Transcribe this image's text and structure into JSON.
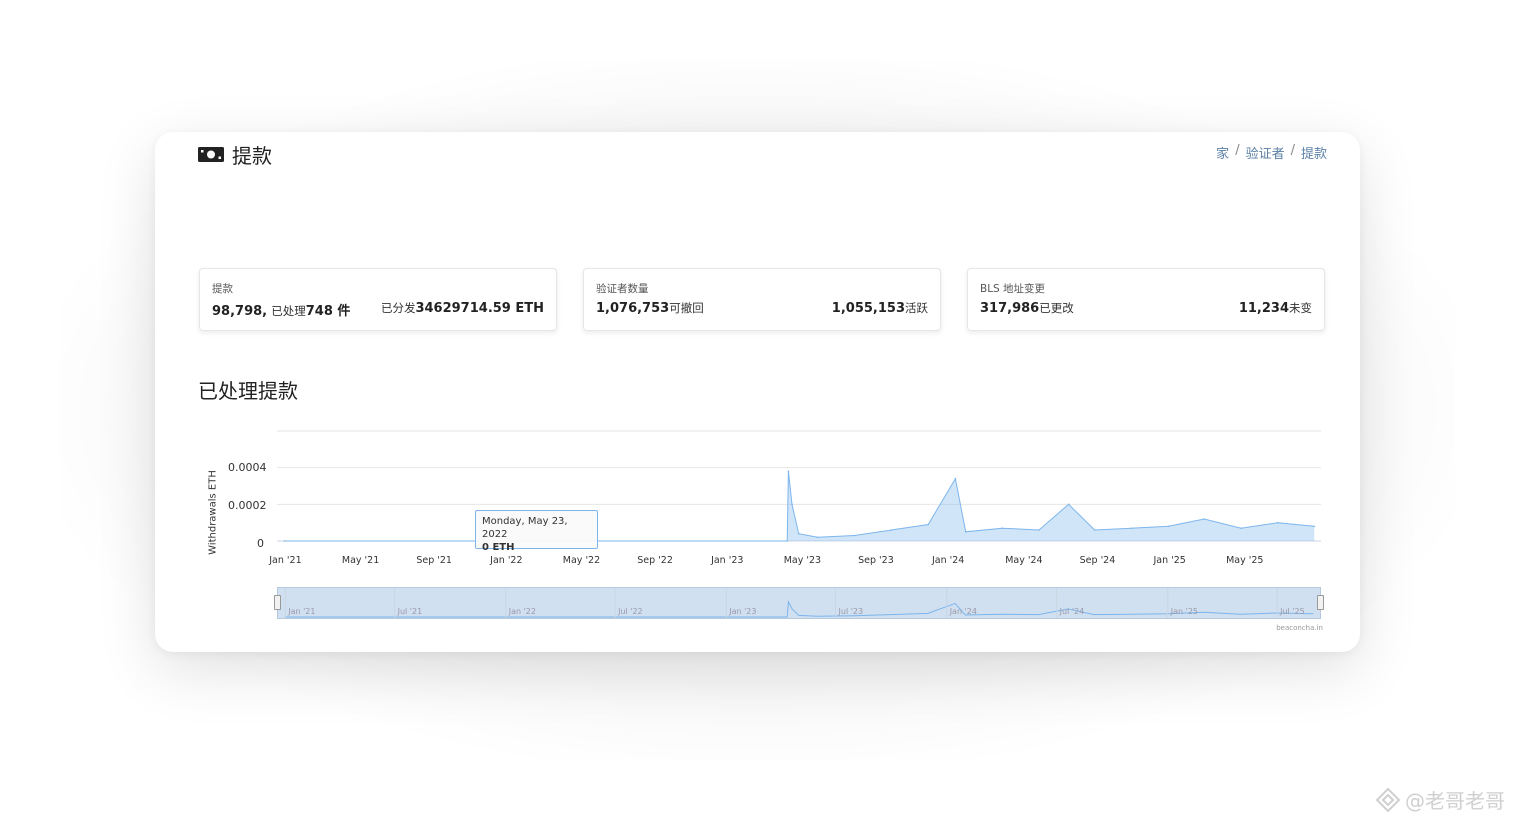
{
  "header": {
    "title": "提款",
    "icon": "money-icon",
    "breadcrumb": [
      "家",
      "验证者",
      "提款"
    ]
  },
  "stats": [
    {
      "label": "提款",
      "left_value": "98,798,",
      "left_small": "已处理",
      "left_count": "748 件",
      "right_small": "已分发",
      "right_value": "34629714.59 ETH"
    },
    {
      "label": "验证者数量",
      "left_value": "1,076,753",
      "left_small": "可撤回",
      "right_value": "1,055,153",
      "right_small": "活跃"
    },
    {
      "label": "BLS 地址变更",
      "left_value": "317,986",
      "left_small": "已更改",
      "right_value": "11,234",
      "right_small": "未变"
    }
  ],
  "section_title": "已处理提款",
  "tooltip": {
    "date": "Monday, May 23, 2022",
    "value": "0 ETH"
  },
  "navigator_labels": [
    "Jan '21",
    "Jul '21",
    "Jan '22",
    "Jul '22",
    "Jan '23",
    "Jul '23",
    "Jan '24",
    "Jul '24",
    "Jan '25",
    "Jul '25"
  ],
  "credits": "beaconcha.in",
  "watermark": "@老哥老哥",
  "colors": {
    "series": "#7cb5ec",
    "link": "#5b7fa6"
  },
  "chart_data": {
    "type": "area",
    "ylabel": "Withdrawals ETH",
    "yticks": [
      "0",
      "0.0002",
      "0.0004"
    ],
    "ylim": [
      0,
      0.0006
    ],
    "xticks": [
      "Jan '21",
      "May '21",
      "Sep '21",
      "Jan '22",
      "May '22",
      "Sep '22",
      "Jan '23",
      "May '23",
      "Sep '23",
      "Jan '24",
      "May '24",
      "Sep '24",
      "Jan '25",
      "May '25"
    ],
    "grid": true,
    "series": [
      {
        "points": [
          [
            "2021-01-01",
            0
          ],
          [
            "2022-05-23",
            0
          ],
          [
            "2023-04-12",
            0
          ],
          [
            "2023-04-14",
            0.00038
          ],
          [
            "2023-04-20",
            0.0002
          ],
          [
            "2023-05-01",
            4e-05
          ],
          [
            "2023-06-01",
            2e-05
          ],
          [
            "2023-08-01",
            3e-05
          ],
          [
            "2023-10-01",
            6e-05
          ],
          [
            "2023-12-01",
            9e-05
          ],
          [
            "2024-01-15",
            0.00034
          ],
          [
            "2024-02-01",
            5e-05
          ],
          [
            "2024-04-01",
            7e-05
          ],
          [
            "2024-06-01",
            6e-05
          ],
          [
            "2024-07-20",
            0.0002
          ],
          [
            "2024-09-01",
            6e-05
          ],
          [
            "2024-11-01",
            7e-05
          ],
          [
            "2025-01-01",
            8e-05
          ],
          [
            "2025-03-01",
            0.00012
          ],
          [
            "2025-05-01",
            7e-05
          ],
          [
            "2025-07-01",
            0.0001
          ],
          [
            "2025-08-30",
            8e-05
          ]
        ]
      }
    ]
  }
}
